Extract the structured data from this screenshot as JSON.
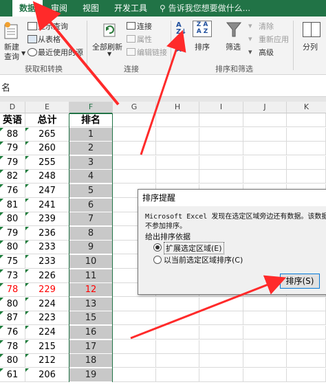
{
  "ribbon": {
    "tabs": [
      {
        "label": "数据",
        "active": true
      },
      {
        "label": "审阅",
        "active": false
      },
      {
        "label": "视图",
        "active": false
      },
      {
        "label": "开发工具",
        "active": false
      }
    ],
    "tell_me": "告诉我您想要做什么...",
    "get_transform": {
      "new_query": "新建",
      "new_query2": "查询",
      "show_query": "显示查询",
      "from_table": "从表格",
      "recent_sources": "最近使用的源",
      "group_label": "获取和转换"
    },
    "connections": {
      "refresh_all": "全部刷新",
      "connections": "连接",
      "properties": "属性",
      "edit_links": "编辑链接",
      "group_label": "连接"
    },
    "sort_filter": {
      "sort": "排序",
      "filter": "筛选",
      "clear": "清除",
      "reapply": "重新应用",
      "advanced": "高级",
      "group_label": "排序和筛选"
    },
    "data_tools": {
      "text_to_columns": "分列"
    }
  },
  "formula_bar": {
    "content": "名"
  },
  "columns": [
    {
      "label": "D",
      "selected": false
    },
    {
      "label": "E",
      "selected": false
    },
    {
      "label": "F",
      "selected": true
    },
    {
      "label": "G",
      "selected": false
    },
    {
      "label": "H",
      "selected": false
    },
    {
      "label": "I",
      "selected": false
    },
    {
      "label": "J",
      "selected": false
    },
    {
      "label": "K",
      "selected": false
    }
  ],
  "sheet": {
    "headers": {
      "d": "英语",
      "e": "总计",
      "f": "排名"
    },
    "rows": [
      {
        "d": "88",
        "e": "265",
        "f": "1",
        "red": false
      },
      {
        "d": "79",
        "e": "260",
        "f": "2",
        "red": false
      },
      {
        "d": "79",
        "e": "255",
        "f": "3",
        "red": false
      },
      {
        "d": "82",
        "e": "248",
        "f": "4",
        "red": false
      },
      {
        "d": "76",
        "e": "247",
        "f": "5",
        "red": false
      },
      {
        "d": "81",
        "e": "241",
        "f": "6",
        "red": false
      },
      {
        "d": "80",
        "e": "239",
        "f": "7",
        "red": false
      },
      {
        "d": "79",
        "e": "236",
        "f": "8",
        "red": false
      },
      {
        "d": "80",
        "e": "233",
        "f": "9",
        "red": false
      },
      {
        "d": "75",
        "e": "233",
        "f": "10",
        "red": false
      },
      {
        "d": "73",
        "e": "226",
        "f": "11",
        "red": false
      },
      {
        "d": "78",
        "e": "229",
        "f": "12",
        "red": true
      },
      {
        "d": "80",
        "e": "224",
        "f": "13",
        "red": false
      },
      {
        "d": "87",
        "e": "223",
        "f": "15",
        "red": false
      },
      {
        "d": "76",
        "e": "224",
        "f": "16",
        "red": false
      },
      {
        "d": "78",
        "e": "215",
        "f": "17",
        "red": false
      },
      {
        "d": "80",
        "e": "212",
        "f": "18",
        "red": false
      },
      {
        "d": "61",
        "e": "206",
        "f": "19",
        "red": false
      }
    ]
  },
  "dialog": {
    "title": "排序提醒",
    "message": "Microsoft Excel 发现在选定区域旁边还有数据。该数据",
    "message2": "不参加排序。",
    "group_label": "给出排序依据",
    "option1": "扩展选定区域(E)",
    "option2": "以当前选定区域排序(C)",
    "sort_button": "排序(S)"
  },
  "colors": {
    "accent": "#217346",
    "arrow": "#ff2a2a"
  }
}
